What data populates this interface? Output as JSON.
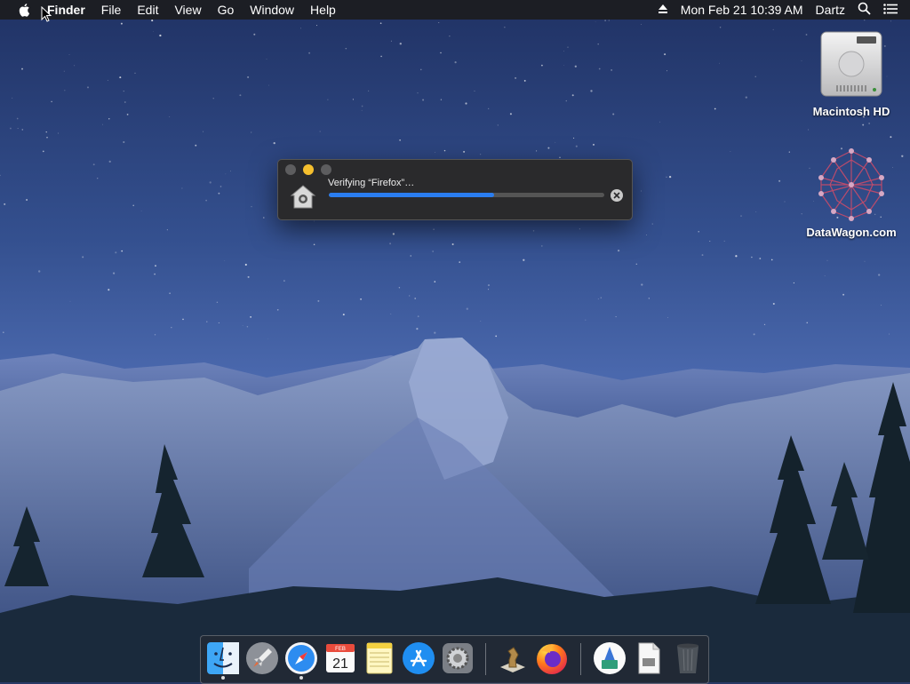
{
  "menubar": {
    "app_name": "Finder",
    "items": [
      "File",
      "Edit",
      "View",
      "Go",
      "Window",
      "Help"
    ],
    "clock": "Mon Feb 21  10:39 AM",
    "user": "Dartz"
  },
  "desktop": {
    "icons": [
      {
        "label": "Macintosh HD",
        "icon": "hard-drive-icon"
      },
      {
        "label": "DataWagon.com",
        "icon": "network-sphere-icon"
      }
    ]
  },
  "verify_window": {
    "title": "Verifying “Firefox”…",
    "progress": 0.6,
    "progress_color": "#2a7df0"
  },
  "calendar_icon": {
    "month": "FEB",
    "day": "21"
  },
  "dock": {
    "items": [
      {
        "name": "Finder",
        "icon": "finder-icon",
        "running": true
      },
      {
        "name": "Launchpad",
        "icon": "launchpad-icon",
        "running": false
      },
      {
        "name": "Safari",
        "icon": "safari-icon",
        "running": true
      },
      {
        "name": "Calendar",
        "icon": "calendar-icon",
        "running": false
      },
      {
        "name": "Notes",
        "icon": "notes-icon",
        "running": false
      },
      {
        "name": "App Store",
        "icon": "app-store-icon",
        "running": false
      },
      {
        "name": "System Preferences",
        "icon": "system-preferences-icon",
        "running": false
      },
      {
        "name": "Chess",
        "icon": "chess-icon",
        "running": false
      },
      {
        "name": "Firefox",
        "icon": "firefox-icon",
        "running": false
      },
      {
        "name": "Downloads",
        "icon": "downloads-icon",
        "running": false
      },
      {
        "name": "Document",
        "icon": "document-icon",
        "running": false
      },
      {
        "name": "Trash",
        "icon": "trash-icon",
        "running": false
      }
    ]
  }
}
